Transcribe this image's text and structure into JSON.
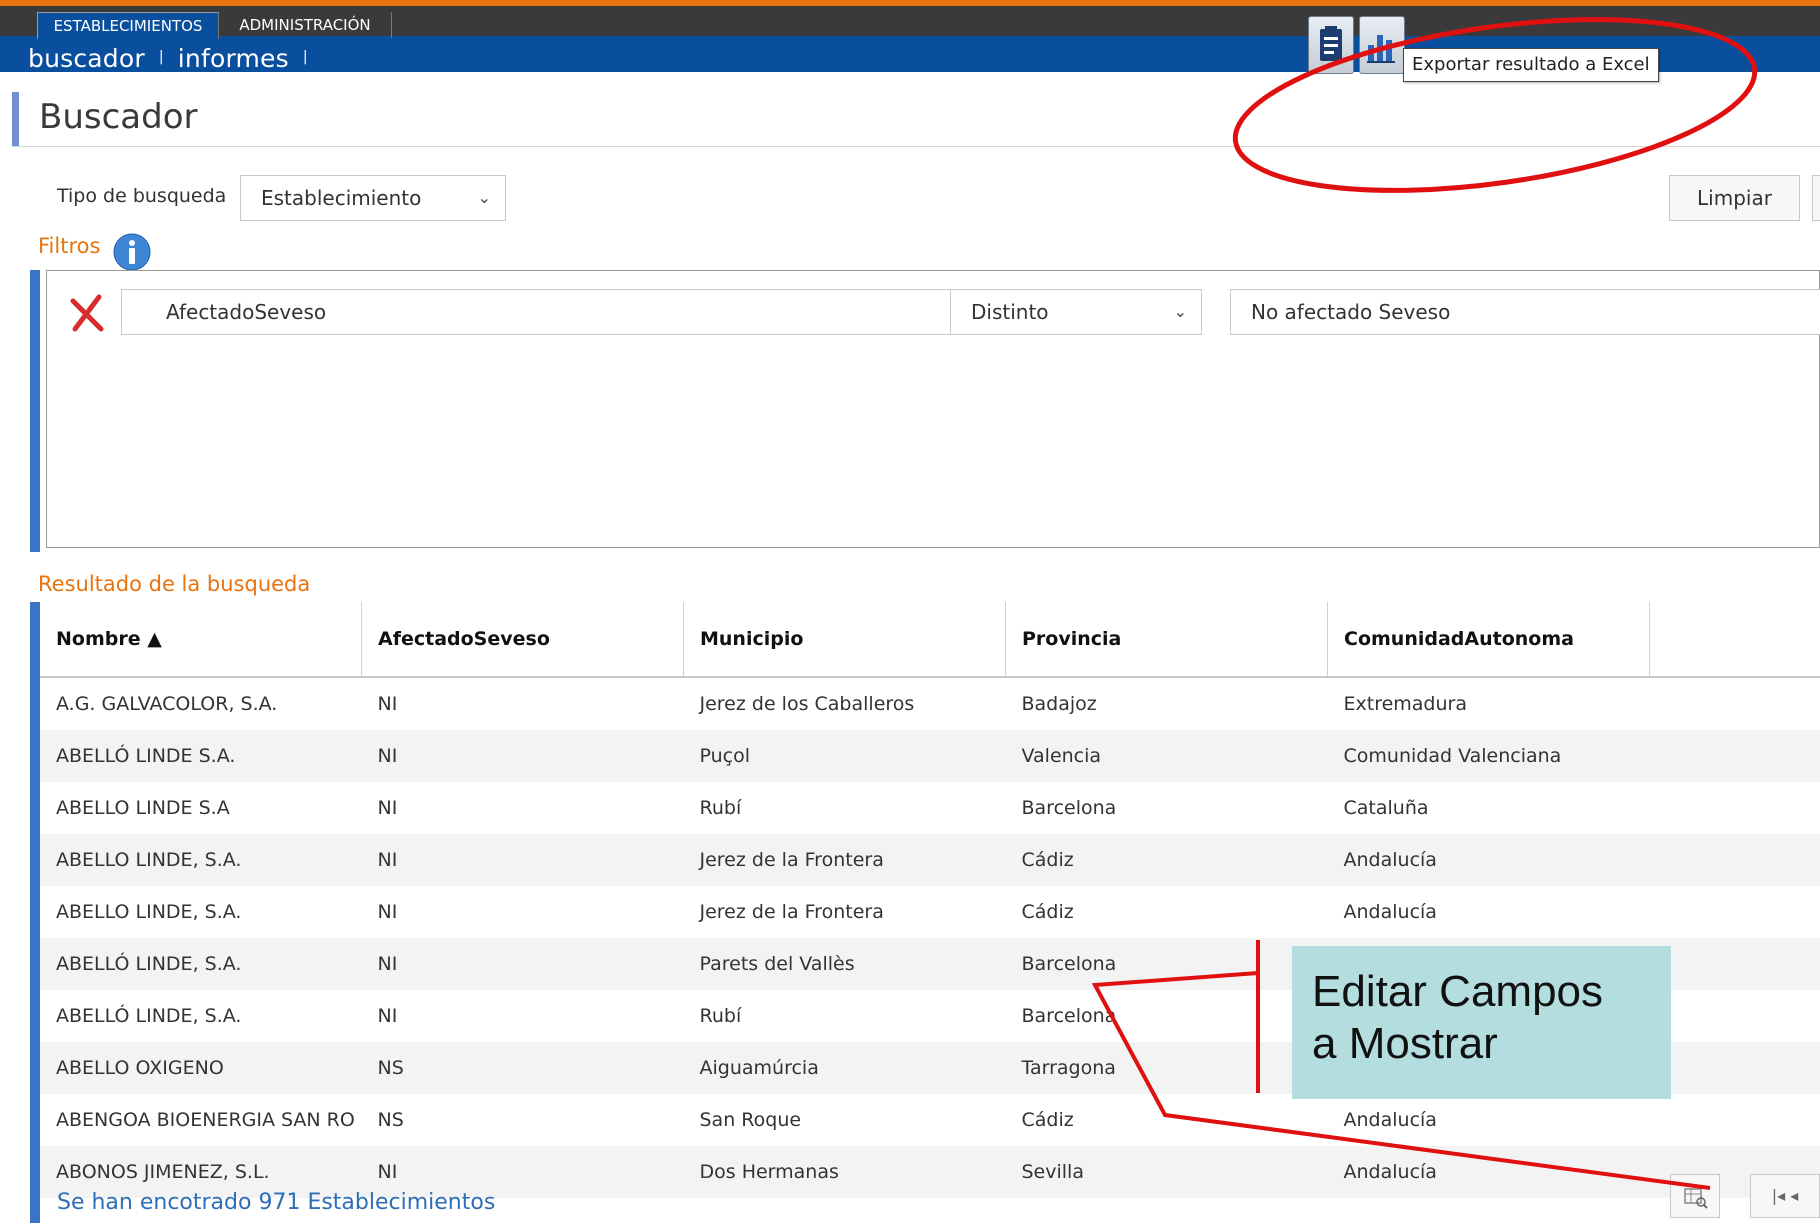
{
  "header": {
    "tabs": [
      "ESTABLECIMIENTOS",
      "ADMINISTRACIÓN"
    ],
    "subnav": [
      "buscador",
      "informes"
    ],
    "tooltip": "Exportar resultado a Excel",
    "colors": {
      "accent": "#e8730f",
      "nav": "#0a4f9e",
      "annotation": "#e01010"
    }
  },
  "page": {
    "title": "Buscador"
  },
  "search": {
    "type_label": "Tipo de busqueda",
    "type_value": "Establecimiento",
    "clear_button": "Limpiar"
  },
  "filters": {
    "label": "Filtros",
    "rows": [
      {
        "field": "AfectadoSeveso",
        "operator": "Distinto",
        "value": "No afectado Seveso"
      }
    ]
  },
  "results": {
    "label": "Resultado de la busqueda",
    "columns": [
      "Nombre ▲",
      "AfectadoSeveso",
      "Municipio",
      "Provincia",
      "ComunidadAutonoma"
    ],
    "rows": [
      [
        "A.G. GALVACOLOR, S.A.",
        "NI",
        "Jerez de los Caballeros",
        "Badajoz",
        "Extremadura"
      ],
      [
        "ABELLÓ  LINDE S.A.",
        "NI",
        "Puçol",
        "Valencia",
        "Comunidad Valenciana"
      ],
      [
        "ABELLO LINDE S.A",
        "NI",
        "Rubí",
        "Barcelona",
        "Cataluña"
      ],
      [
        "ABELLO LINDE, S.A.",
        "NI",
        "Jerez de la Frontera",
        "Cádiz",
        "Andalucía"
      ],
      [
        "ABELLO LINDE, S.A.",
        "NI",
        "Jerez de la Frontera",
        "Cádiz",
        "Andalucía"
      ],
      [
        "ABELLÓ LINDE, S.A.",
        "NI",
        "Parets del Vallès",
        "Barcelona",
        ""
      ],
      [
        "ABELLÓ LINDE, S.A.",
        "NI",
        "Rubí",
        "Barcelona",
        ""
      ],
      [
        "ABELLO OXIGENO",
        "NS",
        "Aiguamúrcia",
        "Tarragona",
        ""
      ],
      [
        "ABENGOA BIOENERGIA SAN RO",
        "NS",
        "San Roque",
        "Cádiz",
        "Andalucía"
      ],
      [
        "ABONOS JIMENEZ, S.L.",
        "NI",
        "Dos Hermanas",
        "Sevilla",
        "Andalucía"
      ]
    ],
    "count_text": "Se han encotrado 971 Establecimientos"
  },
  "annotation": {
    "text_line1": "Editar Campos",
    "text_line2": "a Mostrar"
  },
  "icons": [
    "clipboard-icon",
    "chart-icon",
    "info-icon",
    "remove-filter-icon",
    "edit-columns-icon",
    "first-page-icon"
  ]
}
